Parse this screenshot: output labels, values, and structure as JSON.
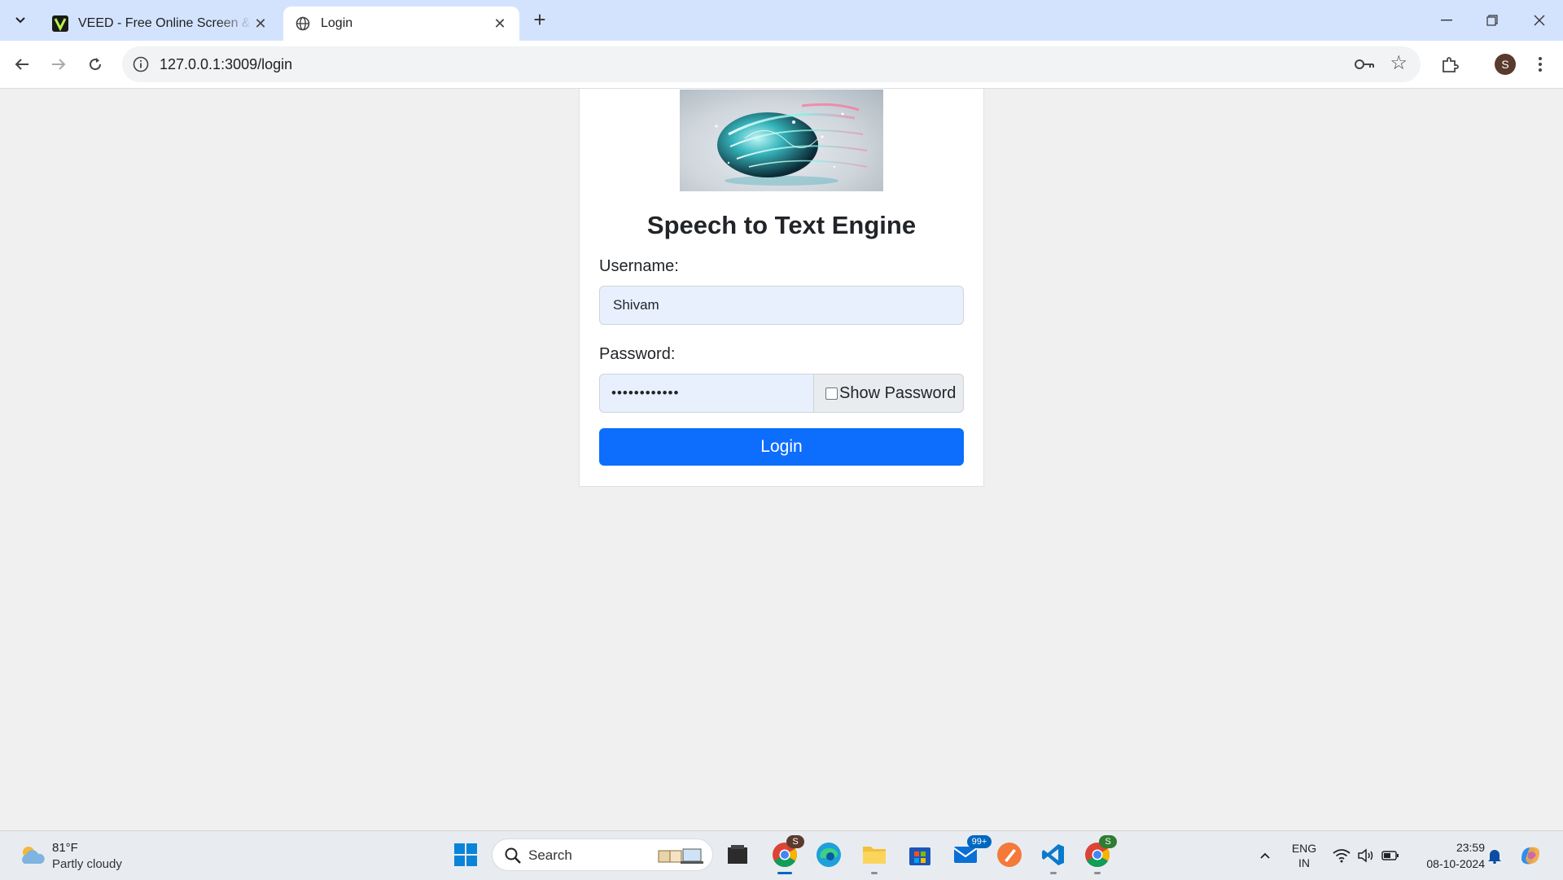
{
  "browser": {
    "tabs": [
      {
        "title": "VEED - Free Online Screen & Webcam Recorder",
        "favicon": "veed-logo-icon",
        "active": false
      },
      {
        "title": "Login",
        "favicon": "globe-icon",
        "active": true
      }
    ],
    "url": "127.0.0.1:3009/login",
    "profile_initial": "S"
  },
  "login": {
    "title": "Speech to Text Engine",
    "username_label": "Username:",
    "username_value": "Shivam",
    "password_label": "Password:",
    "password_value": "••••••••••••",
    "show_password_label": "Show Password",
    "show_password_checked": false,
    "login_button": "Login"
  },
  "taskbar": {
    "weather_temp": "81°F",
    "weather_condition": "Partly cloudy",
    "search_placeholder": "Search",
    "mail_badge": "99+",
    "chrome_badge": "S",
    "chrome2_badge": "S",
    "lang_line1": "ENG",
    "lang_line2": "IN",
    "time": "23:59",
    "date": "08-10-2024"
  },
  "colors": {
    "accent": "#0d6efd",
    "tabbar": "#d3e3fd",
    "input_autofill": "#e8f0fe"
  }
}
